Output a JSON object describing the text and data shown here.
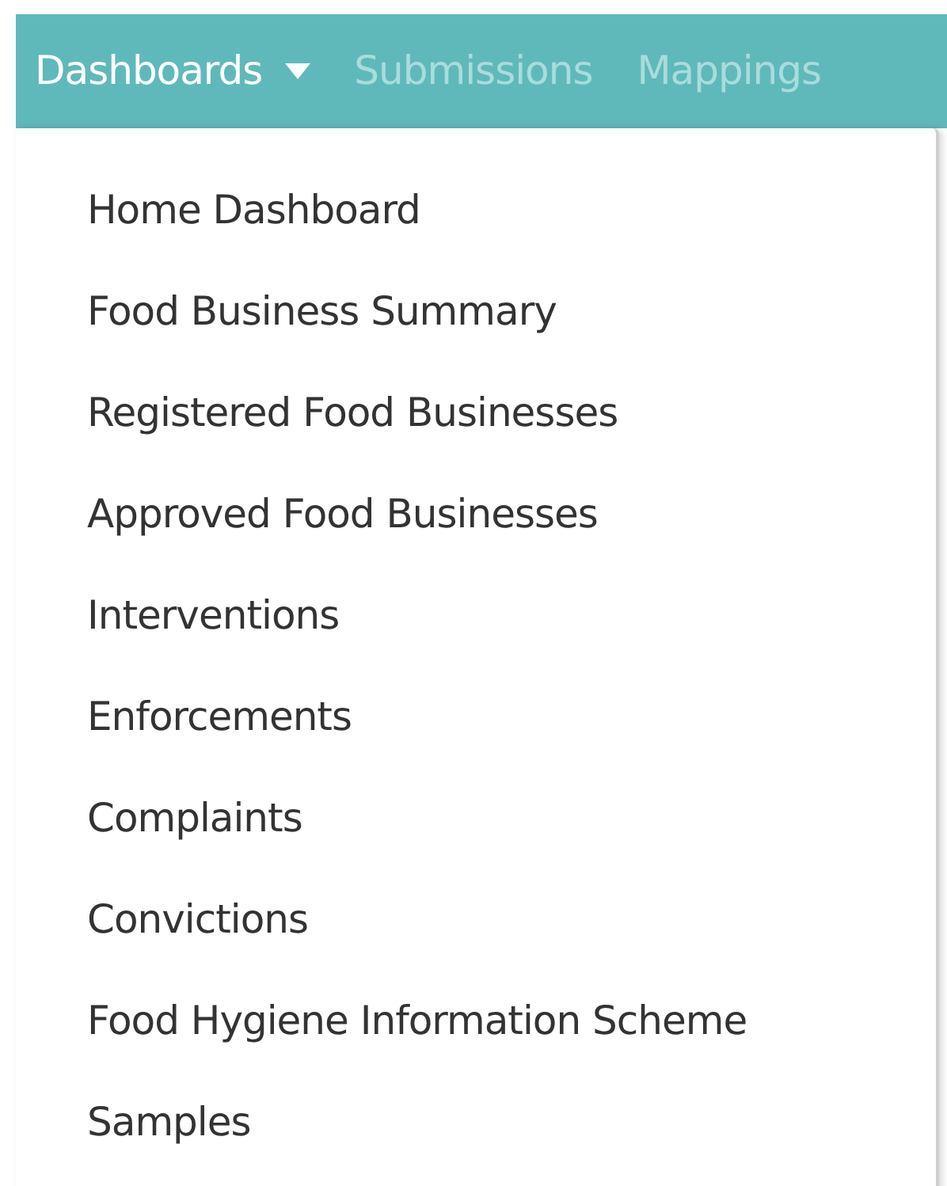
{
  "navbar": {
    "items": [
      {
        "label": "Dashboards",
        "selected": true,
        "has_caret": true
      },
      {
        "label": "Submissions",
        "selected": false,
        "has_caret": false
      },
      {
        "label": "Mappings",
        "selected": false,
        "has_caret": false
      }
    ]
  },
  "dropdown": {
    "items": [
      {
        "label": "Home Dashboard"
      },
      {
        "label": "Food Business Summary"
      },
      {
        "label": "Registered Food Businesses"
      },
      {
        "label": "Approved Food Businesses"
      },
      {
        "label": "Interventions"
      },
      {
        "label": "Enforcements"
      },
      {
        "label": "Complaints"
      },
      {
        "label": "Convictions"
      },
      {
        "label": "Food Hygiene Information Scheme"
      },
      {
        "label": "Samples"
      }
    ]
  }
}
